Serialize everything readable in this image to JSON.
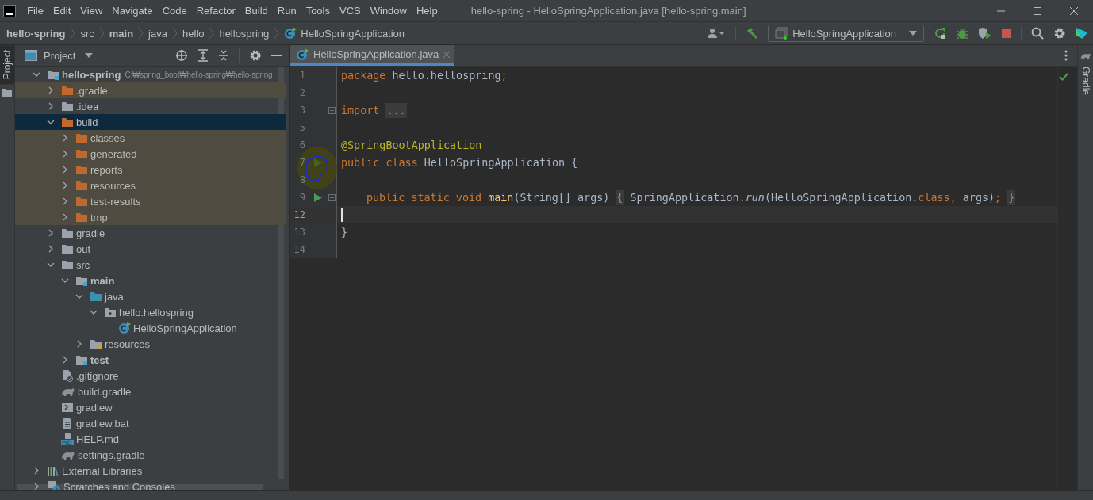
{
  "title_bar": {
    "menus": [
      "File",
      "Edit",
      "View",
      "Navigate",
      "Code",
      "Refactor",
      "Build",
      "Run",
      "Tools",
      "VCS",
      "Window",
      "Help"
    ],
    "title": "hello-spring - HelloSpringApplication.java [hello-spring.main]"
  },
  "breadcrumbs": [
    {
      "label": "hello-spring",
      "kind": "bold"
    },
    {
      "label": "src",
      "kind": "plain"
    },
    {
      "label": "main",
      "kind": "bold"
    },
    {
      "label": "java",
      "kind": "plain"
    },
    {
      "label": "hello",
      "kind": "plain"
    },
    {
      "label": "hellospring",
      "kind": "plain"
    },
    {
      "label": "HelloSpringApplication",
      "kind": "class"
    }
  ],
  "toolbar": {
    "run_configuration": "HelloSpringApplication"
  },
  "side_tabs": {
    "left": {
      "label": "Project",
      "selected": true
    },
    "right": {
      "label": "Gradle",
      "selected": false
    }
  },
  "project": {
    "title": "Project",
    "tree": [
      {
        "label": "hello-spring",
        "hint": "C:₩spring_boot₩hello-spring₩hello-spring",
        "kind": "project",
        "expanded": true,
        "excluded": false,
        "selected": false,
        "children": [
          {
            "label": ".gradle",
            "kind": "folder",
            "expanded": false,
            "excluded": true,
            "selected": false
          },
          {
            "label": ".idea",
            "kind": "folder",
            "expanded": false,
            "excluded": false,
            "selected": false
          },
          {
            "label": "build",
            "kind": "folder",
            "expanded": true,
            "excluded": true,
            "selected": true,
            "children": [
              {
                "label": "classes",
                "kind": "folder",
                "expanded": false,
                "excluded": true,
                "selected": false
              },
              {
                "label": "generated",
                "kind": "folder",
                "expanded": false,
                "excluded": true,
                "selected": false
              },
              {
                "label": "reports",
                "kind": "folder",
                "expanded": false,
                "excluded": true,
                "selected": false
              },
              {
                "label": "resources",
                "kind": "folder",
                "expanded": false,
                "excluded": true,
                "selected": false
              },
              {
                "label": "test-results",
                "kind": "folder",
                "expanded": false,
                "excluded": true,
                "selected": false
              },
              {
                "label": "tmp",
                "kind": "folder",
                "expanded": false,
                "excluded": true,
                "selected": false
              }
            ]
          },
          {
            "label": "gradle",
            "kind": "folder",
            "expanded": false,
            "excluded": false,
            "selected": false
          },
          {
            "label": "out",
            "kind": "folder",
            "expanded": false,
            "excluded": false,
            "selected": false
          },
          {
            "label": "src",
            "kind": "folder",
            "expanded": true,
            "excluded": false,
            "selected": false,
            "children": [
              {
                "label": "main",
                "kind": "module",
                "expanded": true,
                "excluded": false,
                "selected": false,
                "children": [
                  {
                    "label": "java",
                    "kind": "source",
                    "expanded": true,
                    "excluded": false,
                    "selected": false,
                    "children": [
                      {
                        "label": "hello.hellospring",
                        "kind": "package",
                        "expanded": true,
                        "excluded": false,
                        "selected": false,
                        "children": [
                          {
                            "label": "HelloSpringApplication",
                            "kind": "class",
                            "excluded": false,
                            "selected": false
                          }
                        ]
                      }
                    ]
                  },
                  {
                    "label": "resources",
                    "kind": "resources",
                    "expanded": false,
                    "excluded": false,
                    "selected": false
                  }
                ]
              },
              {
                "label": "test",
                "kind": "module",
                "expanded": false,
                "excluded": false,
                "selected": false
              }
            ]
          },
          {
            "label": ".gitignore",
            "kind": "ignore",
            "excluded": false,
            "selected": false
          },
          {
            "label": "build.gradle",
            "kind": "gradle",
            "excluded": false,
            "selected": false
          },
          {
            "label": "gradlew",
            "kind": "shell",
            "excluded": false,
            "selected": false
          },
          {
            "label": "gradlew.bat",
            "kind": "text",
            "excluded": false,
            "selected": false
          },
          {
            "label": "HELP.md",
            "kind": "markdown",
            "excluded": false,
            "selected": false
          },
          {
            "label": "settings.gradle",
            "kind": "gradle",
            "excluded": false,
            "selected": false
          }
        ]
      },
      {
        "label": "External Libraries",
        "kind": "libraries",
        "expanded": false,
        "excluded": false,
        "selected": false
      },
      {
        "label": "Scratches and Consoles",
        "kind": "scratches",
        "expanded": false,
        "excluded": false,
        "selected": false
      }
    ]
  },
  "editor": {
    "tab": {
      "label": "HelloSpringApplication.java",
      "selected": true
    },
    "lines": [
      {
        "number": "1",
        "run": false,
        "fold": false,
        "current": false,
        "tokens": [
          {
            "kind": "kw",
            "text": "package "
          },
          {
            "kind": "plain",
            "text": "hello.hellospring"
          },
          {
            "kind": "kw",
            "text": ";"
          }
        ]
      },
      {
        "number": "2",
        "run": false,
        "fold": false,
        "current": false
      },
      {
        "number": "3",
        "run": false,
        "fold": true,
        "current": false,
        "tokens": [
          {
            "kind": "kw",
            "text": "import "
          },
          {
            "kind": "folded",
            "text": "..."
          }
        ]
      },
      {
        "number": "5",
        "run": false,
        "fold": false,
        "current": false
      },
      {
        "number": "6",
        "run": false,
        "fold": false,
        "current": false,
        "tokens": [
          {
            "kind": "annotation",
            "text": "@SpringBootApplication"
          }
        ]
      },
      {
        "number": "7",
        "run": true,
        "fold": false,
        "current": false,
        "tokens": [
          {
            "kind": "kw",
            "text": "public class "
          },
          {
            "kind": "plain",
            "text": "HelloSpringApplication {"
          }
        ]
      },
      {
        "number": "8",
        "run": false,
        "fold": false,
        "current": false
      },
      {
        "number": "9",
        "run": true,
        "fold": true,
        "current": false,
        "indented": true,
        "tokens": [
          {
            "kind": "kw",
            "text": "public static void "
          },
          {
            "kind": "method",
            "text": "main"
          },
          {
            "kind": "plain",
            "text": "(String[] args) "
          },
          {
            "kind": "folded",
            "text": "{"
          },
          {
            "kind": "plain",
            "text": " SpringApplication."
          },
          {
            "kind": "italic",
            "text": "run"
          },
          {
            "kind": "plain",
            "text": "(HelloSpringApplication."
          },
          {
            "kind": "kw",
            "text": "class, "
          },
          {
            "kind": "plain",
            "text": "args)"
          },
          {
            "kind": "kw",
            "text": "; "
          },
          {
            "kind": "folded",
            "text": "}"
          }
        ]
      },
      {
        "number": "12",
        "run": false,
        "fold": false,
        "current": true
      },
      {
        "number": "13",
        "run": false,
        "fold": false,
        "current": false,
        "tokens": [
          {
            "kind": "plain",
            "text": "}"
          }
        ]
      },
      {
        "number": "14",
        "run": false,
        "fold": false,
        "current": false
      }
    ]
  }
}
